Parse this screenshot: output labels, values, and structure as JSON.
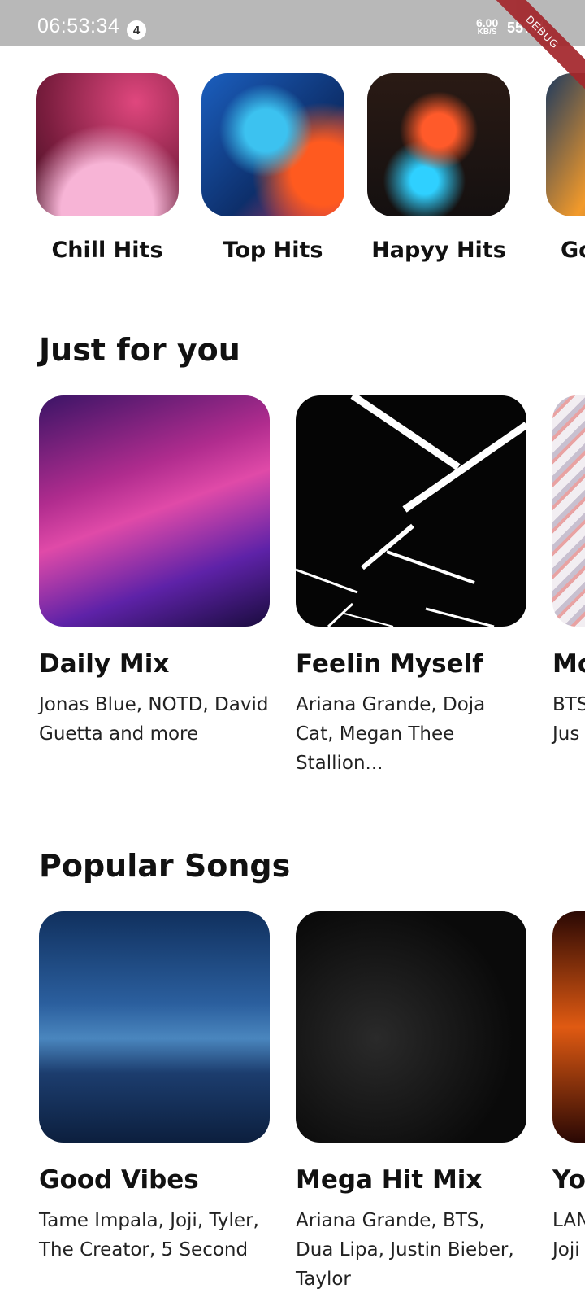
{
  "status_bar": {
    "time": "06:53:34",
    "notification_count": "4",
    "net_speed_value": "6.00",
    "net_speed_unit": "KB/S",
    "battery": "55%",
    "debug_banner": "DEBUG"
  },
  "categories": [
    {
      "label": "Chill Hits",
      "icon": "image"
    },
    {
      "label": "Top Hits",
      "icon": "image"
    },
    {
      "label": "Hapyy Hits",
      "icon": "image"
    },
    {
      "label": "Go",
      "icon": "image"
    }
  ],
  "just_for_you": {
    "title": "Just for you",
    "cards": [
      {
        "title": "Daily Mix",
        "subtitle": "Jonas Blue, NOTD, David Guetta and more"
      },
      {
        "title": "Feelin Myself",
        "subtitle": "Ariana Grande, Doja Cat, Megan Thee Stallion..."
      },
      {
        "title": "Mo",
        "subtitle": "BTS Jus"
      }
    ]
  },
  "popular_songs": {
    "title": "Popular Songs",
    "cards": [
      {
        "title": "Good Vibes",
        "subtitle": "Tame Impala, Joji, Tyler, The Creator, 5 Second"
      },
      {
        "title": "Mega Hit Mix",
        "subtitle": "Ariana Grande, BTS, Dua Lipa, Justin Bieber, Taylor"
      },
      {
        "title": "Yo",
        "subtitle": "LAN Joji"
      }
    ]
  }
}
